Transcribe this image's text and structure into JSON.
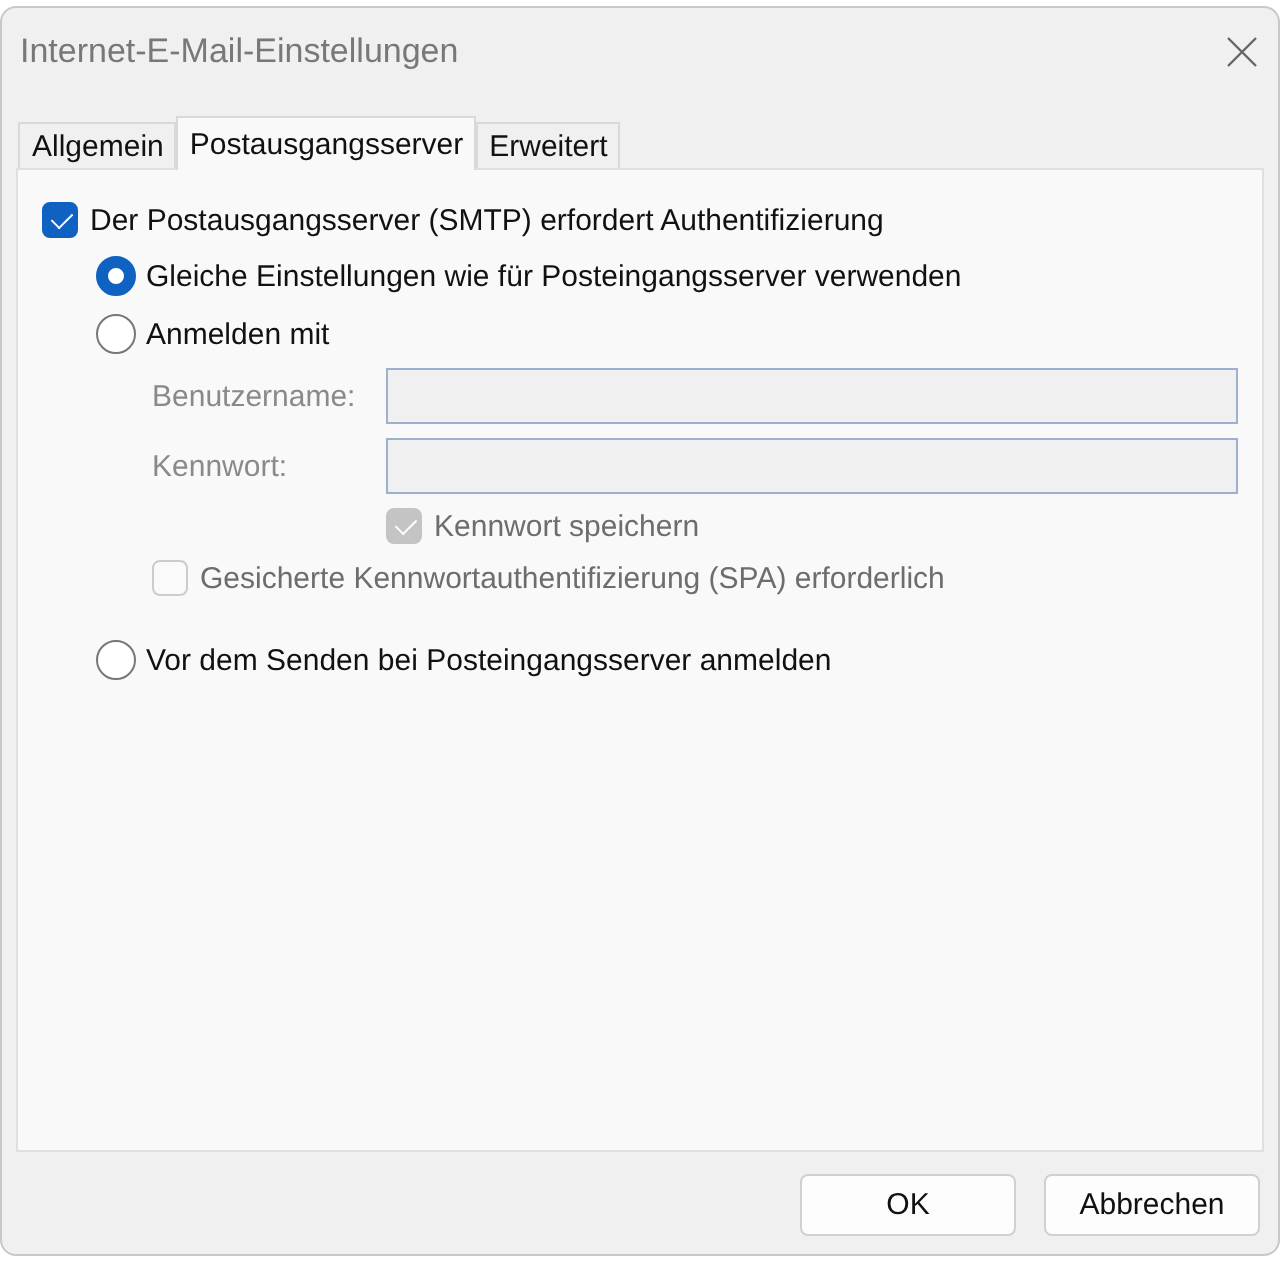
{
  "window": {
    "title": "Internet-E-Mail-Einstellungen"
  },
  "tabs": [
    {
      "label": "Allgemein",
      "selected": false
    },
    {
      "label": "Postausgangsserver",
      "selected": true
    },
    {
      "label": "Erweitert",
      "selected": false
    }
  ],
  "auth": {
    "label": "Der Postausgangsserver (SMTP) erfordert Authentifizierung",
    "checked": true,
    "choices": [
      {
        "label": "Gleiche Einstellungen wie für Posteingangsserver verwenden",
        "selected": true
      },
      {
        "label": "Anmelden mit",
        "selected": false,
        "credentials": {
          "disabled": true,
          "fields": [
            {
              "label": "Benutzername:"
            },
            {
              "label": "Kennwort:"
            }
          ],
          "save_password": {
            "label": "Kennwort speichern",
            "checked": true
          },
          "spa": {
            "label": "Gesicherte Kennwortauthentifizierung (SPA) erforderlich",
            "checked": false
          }
        }
      },
      {
        "label": "Vor dem Senden bei Posteingangsserver anmelden",
        "selected": false
      }
    ]
  },
  "buttons": [
    "OK",
    "Abbrechen"
  ]
}
